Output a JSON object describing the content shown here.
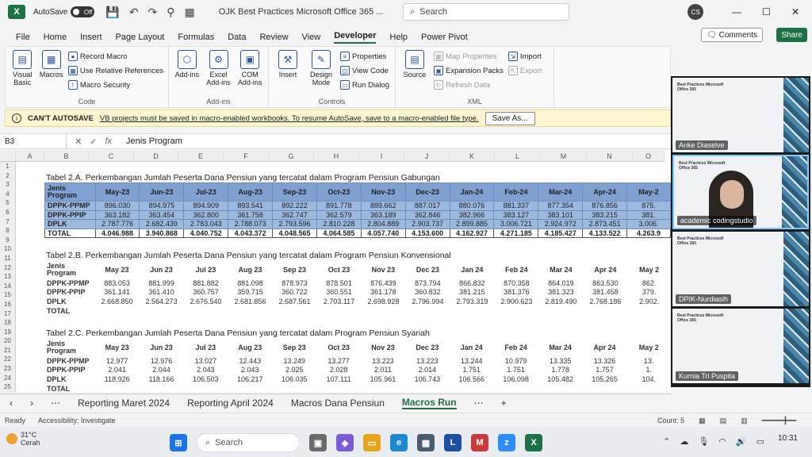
{
  "titlebar": {
    "autosave_label": "AutoSave",
    "autosave_state": "Off",
    "doc_title": "OJK Best Practices Microsoft Office 365 ...",
    "search_placeholder": "Search",
    "avatar": "CS"
  },
  "menu": [
    "File",
    "Home",
    "Insert",
    "Page Layout",
    "Formulas",
    "Data",
    "Review",
    "View",
    "Developer",
    "Help",
    "Power Pivot"
  ],
  "menu_active": "Developer",
  "comments_label": "Comments",
  "share_label": "Share",
  "ribbon": {
    "code": {
      "label": "Code",
      "visual_basic": "Visual Basic",
      "macros": "Macros",
      "record_macro": "Record Macro",
      "relative_refs": "Use Relative References",
      "macro_security": "Macro Security"
    },
    "addins": {
      "label": "Add-ins",
      "addins": "Add-ins",
      "excel_addins": "Excel Add-ins",
      "com_addins": "COM Add-ins"
    },
    "controls": {
      "label": "Controls",
      "insert": "Insert",
      "design_mode": "Design Mode",
      "properties": "Properties",
      "view_code": "View Code",
      "run_dialog": "Run Dialog"
    },
    "xml": {
      "label": "XML",
      "source": "Source",
      "map_properties": "Map Properties",
      "expansion_packs": "Expansion Packs",
      "refresh_data": "Refresh Data",
      "import": "Import",
      "export": "Export"
    }
  },
  "message": {
    "title": "CAN'T AUTOSAVE",
    "text": "VB projects must be saved in macro-enabled workbooks. To resume AutoSave, save to a macro-enabled file type.",
    "button": "Save As..."
  },
  "formula": {
    "cell": "B3",
    "value": "Jenis Program"
  },
  "columns": [
    "A",
    "B",
    "C",
    "D",
    "E",
    "F",
    "G",
    "H",
    "I",
    "J",
    "K",
    "L",
    "M",
    "N",
    "O"
  ],
  "rows": [
    "1",
    "2",
    "3",
    "4",
    "5",
    "6",
    "7",
    "8",
    "9",
    "10",
    "11",
    "12",
    "13",
    "14",
    "15",
    "16",
    "17",
    "18",
    "19",
    "20",
    "21",
    "22",
    "23",
    "24",
    "25"
  ],
  "months": [
    "May-23",
    "Jun-23",
    "Jul-23",
    "Aug-23",
    "Sep-23",
    "Oct-23",
    "Nov-23",
    "Dec-23",
    "Jan-24",
    "Feb-24",
    "Mar-24",
    "Apr-24",
    "May-2"
  ],
  "months_plain": [
    "May 23",
    "Jun 23",
    "Jul 23",
    "Aug 23",
    "Sep 23",
    "Oct 23",
    "Nov 23",
    "Dec 23",
    "Jan 24",
    "Feb 24",
    "Mar 24",
    "Apr 24",
    "May 2"
  ],
  "table_a": {
    "title": "Tabel 2.A. Perkembangan Jumlah Peserta Dana Pensiun yang tercatat dalam Program Pensiun Gabungan",
    "header": "Jenis Program",
    "rows": [
      {
        "label": "DPPK-PPMP",
        "values": [
          "896.030",
          "894.975",
          "894.909",
          "893.541",
          "892.222",
          "891.778",
          "889.662",
          "887.017",
          "880.076",
          "881.337",
          "877.354",
          "876.856",
          "875."
        ]
      },
      {
        "label": "DPPK-PPIP",
        "values": [
          "363.182",
          "363.454",
          "362.800",
          "361.758",
          "362.747",
          "362.579",
          "363.189",
          "362.846",
          "382.966",
          "383.127",
          "383.101",
          "383.215",
          "381."
        ]
      },
      {
        "label": "DPLK",
        "values": [
          "2.787.776",
          "2.682.439",
          "2.783.043",
          "2.788.073",
          "2.793.596",
          "2.810.228",
          "2.804.889",
          "2.903.737",
          "2.899.885",
          "3.006.721",
          "2.924.972",
          "2.873.451",
          "3.006."
        ]
      }
    ],
    "total": {
      "label": "TOTAL",
      "values": [
        "4.046.988",
        "3.940.868",
        "4.040.752",
        "4.043.372",
        "4.048.565",
        "4.064.585",
        "4.057.740",
        "4.153.600",
        "4.162.927",
        "4.271.185",
        "4.185.427",
        "4.133.522",
        "4.263.9"
      ]
    }
  },
  "table_b": {
    "title": "Tabel 2.B. Perkembangan Jumlah Peserta Dana Pensiun yang tercatat dalam Program Pensiun Konvensional",
    "header": "Jenis Program",
    "rows": [
      {
        "label": "DPPK-PPMP",
        "values": [
          "883.053",
          "881.999",
          "881.882",
          "881.098",
          "878.973",
          "878.501",
          "876.439",
          "873.794",
          "866.832",
          "870.358",
          "864.019",
          "863.530",
          "862."
        ]
      },
      {
        "label": "DPPK-PPIP",
        "values": [
          "361.141",
          "361.410",
          "360.757",
          "359.715",
          "360.722",
          "360.551",
          "361.178",
          "360.832",
          "381.215",
          "381.376",
          "381.323",
          "381.458",
          "379."
        ]
      },
      {
        "label": "DPLK",
        "values": [
          "2.668.850",
          "2.564.273",
          "2.676.540",
          "2.681.856",
          "2.687.561",
          "2.703.117",
          "2.698.928",
          "2.796.994",
          "2.793.319",
          "2.900.623",
          "2.819.490",
          "2.768.186",
          "2.902."
        ]
      }
    ],
    "total": {
      "label": "TOTAL",
      "values": [
        "",
        "",
        "",
        "",
        "",
        "",
        "",
        "",
        "",
        "",
        "",
        "",
        ""
      ]
    }
  },
  "table_c": {
    "title": "Tabel 2.C. Perkembangan Jumlah Peserta Dana Pensiun yang tercatat dalam Program Pensiun Syariah",
    "header": "Jenis Program",
    "rows": [
      {
        "label": "DPPK-PPMP",
        "values": [
          "12.977",
          "12.976",
          "13.027",
          "12.443",
          "13.249",
          "13.277",
          "13.223",
          "13.223",
          "13.244",
          "10.979",
          "13.335",
          "13.326",
          "13."
        ]
      },
      {
        "label": "DPPK-PPIP",
        "values": [
          "2.041",
          "2.044",
          "2.043",
          "2.043",
          "2.025",
          "2.028",
          "2.011",
          "2.014",
          "1.751",
          "1.751",
          "1.778",
          "1.757",
          "1."
        ]
      },
      {
        "label": "DPLK",
        "values": [
          "118.926",
          "118.166",
          "106.503",
          "106.217",
          "106.035",
          "107.111",
          "105.961",
          "106.743",
          "106.566",
          "106.098",
          "105.482",
          "105.265",
          "104."
        ]
      }
    ],
    "total": {
      "label": "TOTAL",
      "values": [
        "",
        "",
        "",
        "",
        "",
        "",
        "",
        "",
        "",
        "",
        "",
        "",
        ""
      ]
    }
  },
  "tabs": [
    "Reporting Maret 2024",
    "Reporting April 2024",
    "Macros Dana Pensiun",
    "Macros Run"
  ],
  "tab_active": "Macros Run",
  "status": {
    "ready": "Ready",
    "accessibility": "Accessibility: Investigate",
    "count": "Count: 5"
  },
  "participants": [
    {
      "name": "Anke Diaselve",
      "slide": "Best Practices Microsoft Office 365"
    },
    {
      "name": "academic codingstudio",
      "slide": "Best Practices Microsoft Office 365"
    },
    {
      "name": "DPIK-Nurdiasih",
      "slide": "Best Practices Microsoft Office 365"
    },
    {
      "name": "Kurnia Tri Puspita",
      "slide": "Best Practices Microsoft Office 365"
    }
  ],
  "taskbar": {
    "temp": "31°C",
    "weather": "Cerah",
    "search": "Search",
    "time": "10:31"
  }
}
